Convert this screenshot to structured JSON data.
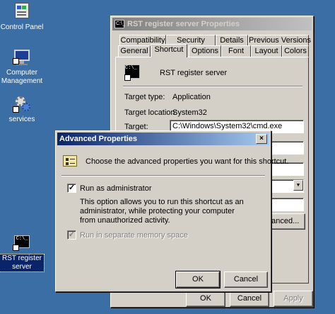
{
  "desktop": {
    "icons": [
      {
        "label": "Control Panel",
        "icon": "control-panel-icon"
      },
      {
        "label": "Computer Management",
        "icon": "computer-management-icon"
      },
      {
        "label": "services",
        "icon": "services-icon"
      },
      {
        "label": "RST register server",
        "icon": "cmd-shortcut-icon"
      }
    ],
    "background_color": "#3a6ea5"
  },
  "properties": {
    "title": "RST register server Properties",
    "tabs_row1": [
      "Compatibility",
      "Security",
      "Details",
      "Previous Versions"
    ],
    "tabs_row2": [
      "General",
      "Shortcut",
      "Options",
      "Font",
      "Layout",
      "Colors"
    ],
    "selected_tab": "Shortcut",
    "shortcut_name": "RST register server",
    "target_type_label": "Target type:",
    "target_type_value": "Application",
    "target_location_label": "Target location:",
    "target_location_value": "System32",
    "target_label": "Target:",
    "target_value": "C:\\Windows\\System32\\cmd.exe",
    "advanced_button_partial": "vanced...",
    "ok_label": "OK",
    "cancel_label": "Cancel",
    "apply_label": "Apply"
  },
  "advanced": {
    "title": "Advanced Properties",
    "intro": "Choose the advanced properties you want for this shortcut.",
    "run_as_admin_label": "Run as administrator",
    "run_as_admin_checked": true,
    "description": "This option allows you to run this shortcut as an administrator, while protecting your computer from unauthorized activity.",
    "separate_memory_label": "Run in separate memory space",
    "separate_memory_checked": true,
    "ok_label": "OK",
    "cancel_label": "Cancel"
  },
  "glyphs": {
    "close": "×",
    "check": "✓",
    "dropdown": "▼",
    "cmd_prompt": "C:\\_"
  }
}
